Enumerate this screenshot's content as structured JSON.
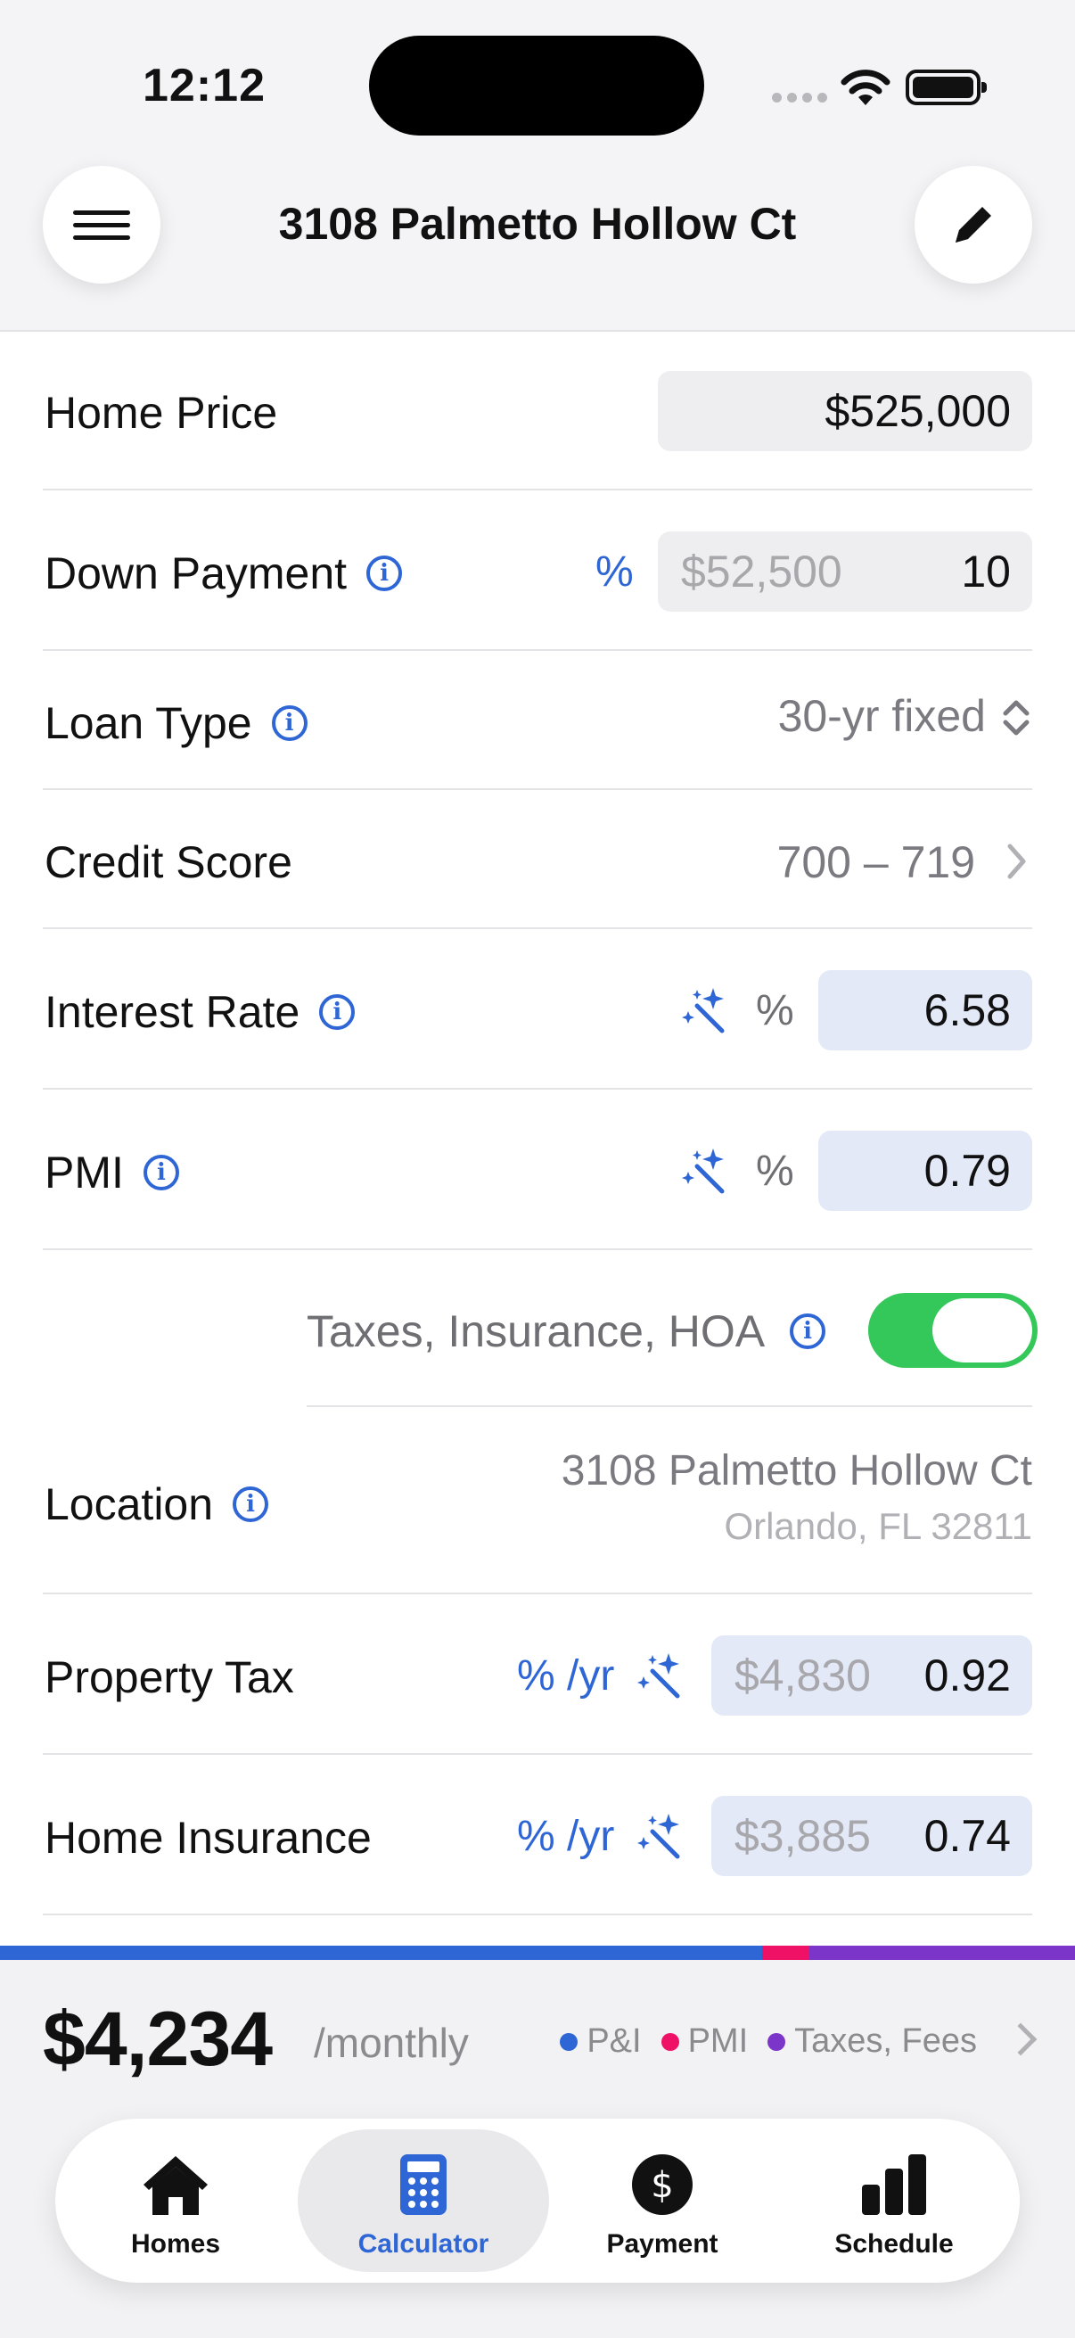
{
  "status_bar": {
    "time": "12:12"
  },
  "header": {
    "title": "3108 Palmetto Hollow Ct",
    "menu_icon": "hamburger-icon",
    "edit_icon": "pencil-icon"
  },
  "form": {
    "home_price": {
      "label": "Home Price",
      "value": "$525,000"
    },
    "down_payment": {
      "label": "Down Payment",
      "unit": "%",
      "amount": "$52,500",
      "value": "10"
    },
    "loan_type": {
      "label": "Loan Type",
      "value": "30-yr fixed"
    },
    "credit_score": {
      "label": "Credit Score",
      "value": "700 – 719"
    },
    "interest_rate": {
      "label": "Interest Rate",
      "unit": "%",
      "value": "6.58"
    },
    "pmi": {
      "label": "PMI",
      "unit": "%",
      "value": "0.79"
    },
    "taxes_toggle": {
      "label": "Taxes, Insurance, HOA",
      "enabled": true
    },
    "location": {
      "label": "Location",
      "address_line1": "3108 Palmetto Hollow Ct",
      "address_line2": "Orlando, FL 32811"
    },
    "property_tax": {
      "label": "Property Tax",
      "unit": "% /yr",
      "amount": "$4,830",
      "value": "0.92"
    },
    "home_insurance": {
      "label": "Home Insurance",
      "unit": "% /yr",
      "amount": "$3,885",
      "value": "0.74"
    }
  },
  "summary": {
    "amount": "$4,234",
    "period": "/monthly",
    "legend": [
      {
        "label": "P&I",
        "color": "#2f66d6"
      },
      {
        "label": "PMI",
        "color": "#ee1166"
      },
      {
        "label": "Taxes, Fees",
        "color": "#7b35c9"
      }
    ],
    "breakdown_fractions": [
      0.709,
      0.044,
      0.247
    ]
  },
  "tabs": [
    {
      "label": "Homes",
      "icon": "house-icon"
    },
    {
      "label": "Calculator",
      "icon": "calculator-icon"
    },
    {
      "label": "Payment",
      "icon": "dollar-circle-icon"
    },
    {
      "label": "Schedule",
      "icon": "bar-chart-icon"
    }
  ],
  "colors": {
    "accent": "#2f66d6",
    "toggle_on": "#34c759"
  }
}
